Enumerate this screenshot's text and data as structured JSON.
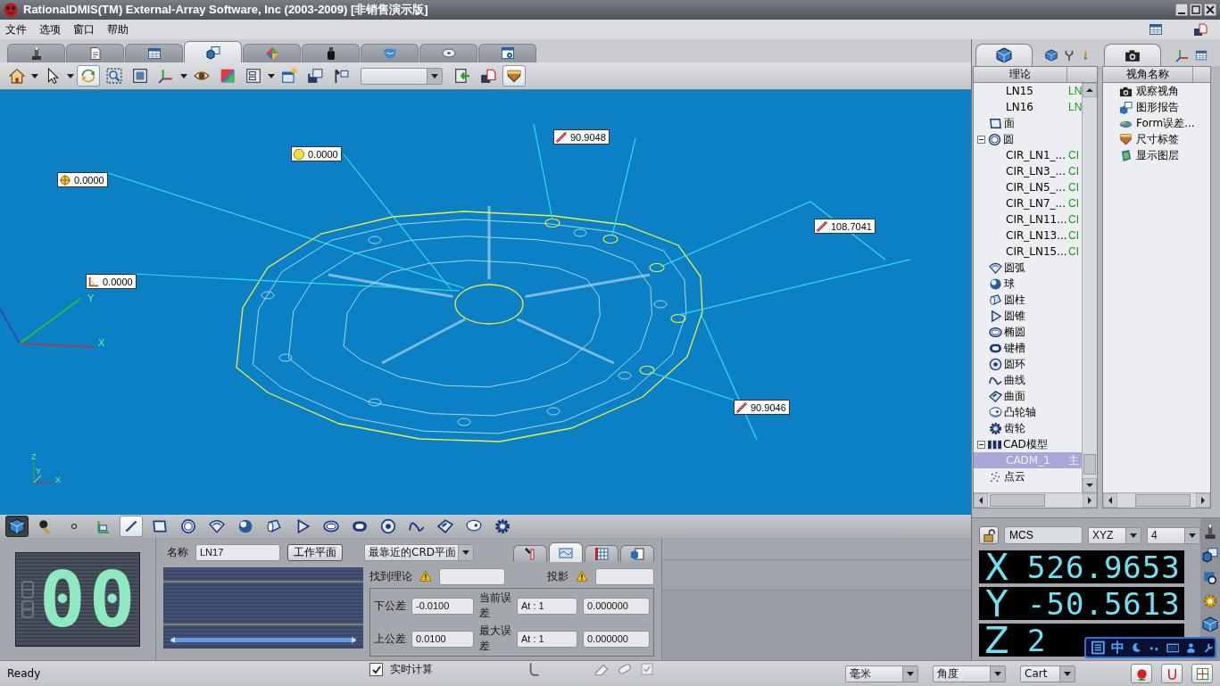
{
  "window": {
    "title": "RationalDMIS(TM) External-Array Software, Inc (2003-2009) [非销售演示版]"
  },
  "menu": [
    {
      "label": "文件"
    },
    {
      "label": "选项"
    },
    {
      "label": "窗口"
    },
    {
      "label": "帮助"
    }
  ],
  "view_tabs": [
    {
      "selected": false
    },
    {
      "selected": false
    },
    {
      "selected": false
    },
    {
      "selected": true
    },
    {
      "selected": false
    },
    {
      "selected": false
    },
    {
      "selected": false
    },
    {
      "selected": false
    },
    {
      "selected": false
    }
  ],
  "toolbar": [
    {
      "selected": false
    },
    {
      "selected": false
    },
    {
      "selected": true
    },
    {
      "selected": false
    },
    {
      "selected": false
    },
    {
      "selected": false
    },
    {
      "selected": false
    },
    {
      "selected": false
    },
    {
      "selected": false
    },
    {
      "selected": false
    },
    {
      "selected": false
    },
    {
      "selected": false
    },
    {
      "selected": false
    },
    {
      "selected": false
    },
    {
      "selected": true
    }
  ],
  "canvas": {
    "labels": [
      {
        "kind": "location",
        "value": "0.0000"
      },
      {
        "kind": "diameter",
        "value": "0.0000"
      },
      {
        "kind": "distance",
        "value": "90.9048"
      },
      {
        "kind": "distance",
        "value": "108.7041"
      },
      {
        "kind": "angle",
        "value": "0.0000"
      },
      {
        "kind": "distance",
        "value": "90.9046"
      }
    ],
    "triad": [
      "X",
      "Y"
    ],
    "mini_triad": [
      "Z",
      "Y",
      "X"
    ]
  },
  "feature_tools": [
    {
      "selected": false
    },
    {
      "selected": false
    },
    {
      "selected": false
    },
    {
      "selected": false
    },
    {
      "selected": true
    },
    {
      "selected": false
    },
    {
      "selected": false
    },
    {
      "selected": false
    },
    {
      "selected": false
    },
    {
      "selected": false
    },
    {
      "selected": false
    },
    {
      "selected": false
    },
    {
      "selected": false
    },
    {
      "selected": false
    },
    {
      "selected": false
    },
    {
      "selected": false
    },
    {
      "selected": false
    },
    {
      "selected": false
    }
  ],
  "counter": {
    "value": "00"
  },
  "feature_panel": {
    "name_label": "名称",
    "name_value": "LN17",
    "workplane_button": "工作平面",
    "plane_combo": "最靠近的CRD平面",
    "tabs": [
      {
        "selected": false
      },
      {
        "selected": true
      },
      {
        "selected": false
      },
      {
        "selected": false
      }
    ],
    "found_label": "找到理论",
    "projection_label": "投影",
    "lower_tol_label": "下公差",
    "lower_tol": "-0.0100",
    "upper_tol_label": "上公差",
    "upper_tol": "0.0100",
    "current_err_label": "当前误差",
    "current_at": "At : 1",
    "current_err": "0.000000",
    "max_err_label": "最大误差",
    "max_at": "At : 1",
    "max_err": "0.000000",
    "realtime": {
      "label": "实时计算",
      "checked": true
    }
  },
  "tree": {
    "column": "理论",
    "items": [
      {
        "children": [
          {
            "label": "LN15",
            "value": "LN",
            "selected": false
          },
          {
            "label": "LN16",
            "value": "LN",
            "selected": false
          }
        ]
      },
      {
        "kind": "plane",
        "label": "面",
        "selected": false
      },
      {
        "kind": "circle",
        "label": "圆",
        "expanded": true,
        "selected": false,
        "children": [
          {
            "label": "CIR_LN1_...",
            "value": "CI",
            "selected": false
          },
          {
            "label": "CIR_LN3_...",
            "value": "CI",
            "selected": false
          },
          {
            "label": "CIR_LN5_...",
            "value": "CI",
            "selected": false
          },
          {
            "label": "CIR_LN7_...",
            "value": "CI",
            "selected": false
          },
          {
            "label": "CIR_LN11...",
            "value": "CI",
            "selected": false
          },
          {
            "label": "CIR_LN13...",
            "value": "CI",
            "selected": false
          },
          {
            "label": "CIR_LN15...",
            "value": "CI",
            "selected": false
          }
        ]
      },
      {
        "kind": "arc",
        "label": "圆弧",
        "selected": false
      },
      {
        "kind": "sphere",
        "label": "球",
        "selected": false
      },
      {
        "kind": "cylinder",
        "label": "圆柱",
        "selected": false
      },
      {
        "kind": "cone",
        "label": "圆锥",
        "selected": false
      },
      {
        "kind": "ellipse",
        "label": "椭圆",
        "selected": false
      },
      {
        "kind": "slot",
        "label": "键槽",
        "selected": false
      },
      {
        "kind": "torus",
        "label": "圆环",
        "selected": false
      },
      {
        "kind": "curve",
        "label": "曲线",
        "selected": false
      },
      {
        "kind": "surface",
        "label": "曲面",
        "selected": false
      },
      {
        "kind": "cam",
        "label": "凸轮轴",
        "selected": false
      },
      {
        "kind": "gear",
        "label": "齿轮",
        "selected": false
      },
      {
        "kind": "cad",
        "label": "CAD模型",
        "expanded": true,
        "selected": false,
        "children": [
          {
            "label": "CADM_1",
            "value": "主",
            "selected": true
          }
        ]
      },
      {
        "kind": "cloud",
        "label": "点云",
        "selected": false
      }
    ]
  },
  "views": {
    "column": "视角名称",
    "items": [
      {
        "label": "观察视角"
      },
      {
        "label": "图形报告"
      },
      {
        "label": "Form误差..."
      },
      {
        "label": "尺寸标签"
      },
      {
        "label": "显示图层"
      }
    ]
  },
  "readout": {
    "system": "MCS",
    "plane": "XYZ",
    "precision": "4",
    "axes": [
      {
        "axis": "X",
        "value": "526.9653"
      },
      {
        "axis": "Y",
        "value": "-50.5613"
      },
      {
        "axis": "Z",
        "value": "2"
      }
    ]
  },
  "ime": {
    "mode": "中"
  },
  "status_bar": {
    "text": "Ready",
    "unit": "毫米",
    "angle": "角度",
    "coords": "Cart"
  }
}
